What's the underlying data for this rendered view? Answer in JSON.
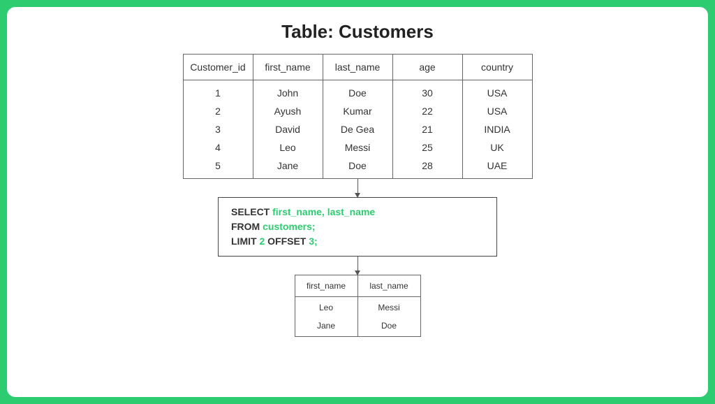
{
  "title": "Table: Customers",
  "source_table": {
    "headers": [
      "Customer_id",
      "first_name",
      "last_name",
      "age",
      "country"
    ],
    "rows": [
      [
        "1",
        "John",
        "Doe",
        "30",
        "USA"
      ],
      [
        "2",
        "Ayush",
        "Kumar",
        "22",
        "USA"
      ],
      [
        "3",
        "David",
        "De Gea",
        "21",
        "INDIA"
      ],
      [
        "4",
        "Leo",
        "Messi",
        "25",
        "UK"
      ],
      [
        "5",
        "Jane",
        "Doe",
        "28",
        "UAE"
      ]
    ]
  },
  "query": {
    "line1_kw": "SELECT ",
    "line1_val": "first_name, last_name",
    "line2_kw": "FROM ",
    "line2_val": "customers;",
    "line3_kw1": "LIMIT ",
    "line3_num1": "2",
    "line3_kw2": " OFFSET ",
    "line3_num2": "3;"
  },
  "result_table": {
    "headers": [
      "first_name",
      "last_name"
    ],
    "rows": [
      [
        "Leo",
        "Messi"
      ],
      [
        "Jane",
        "Doe"
      ]
    ]
  }
}
